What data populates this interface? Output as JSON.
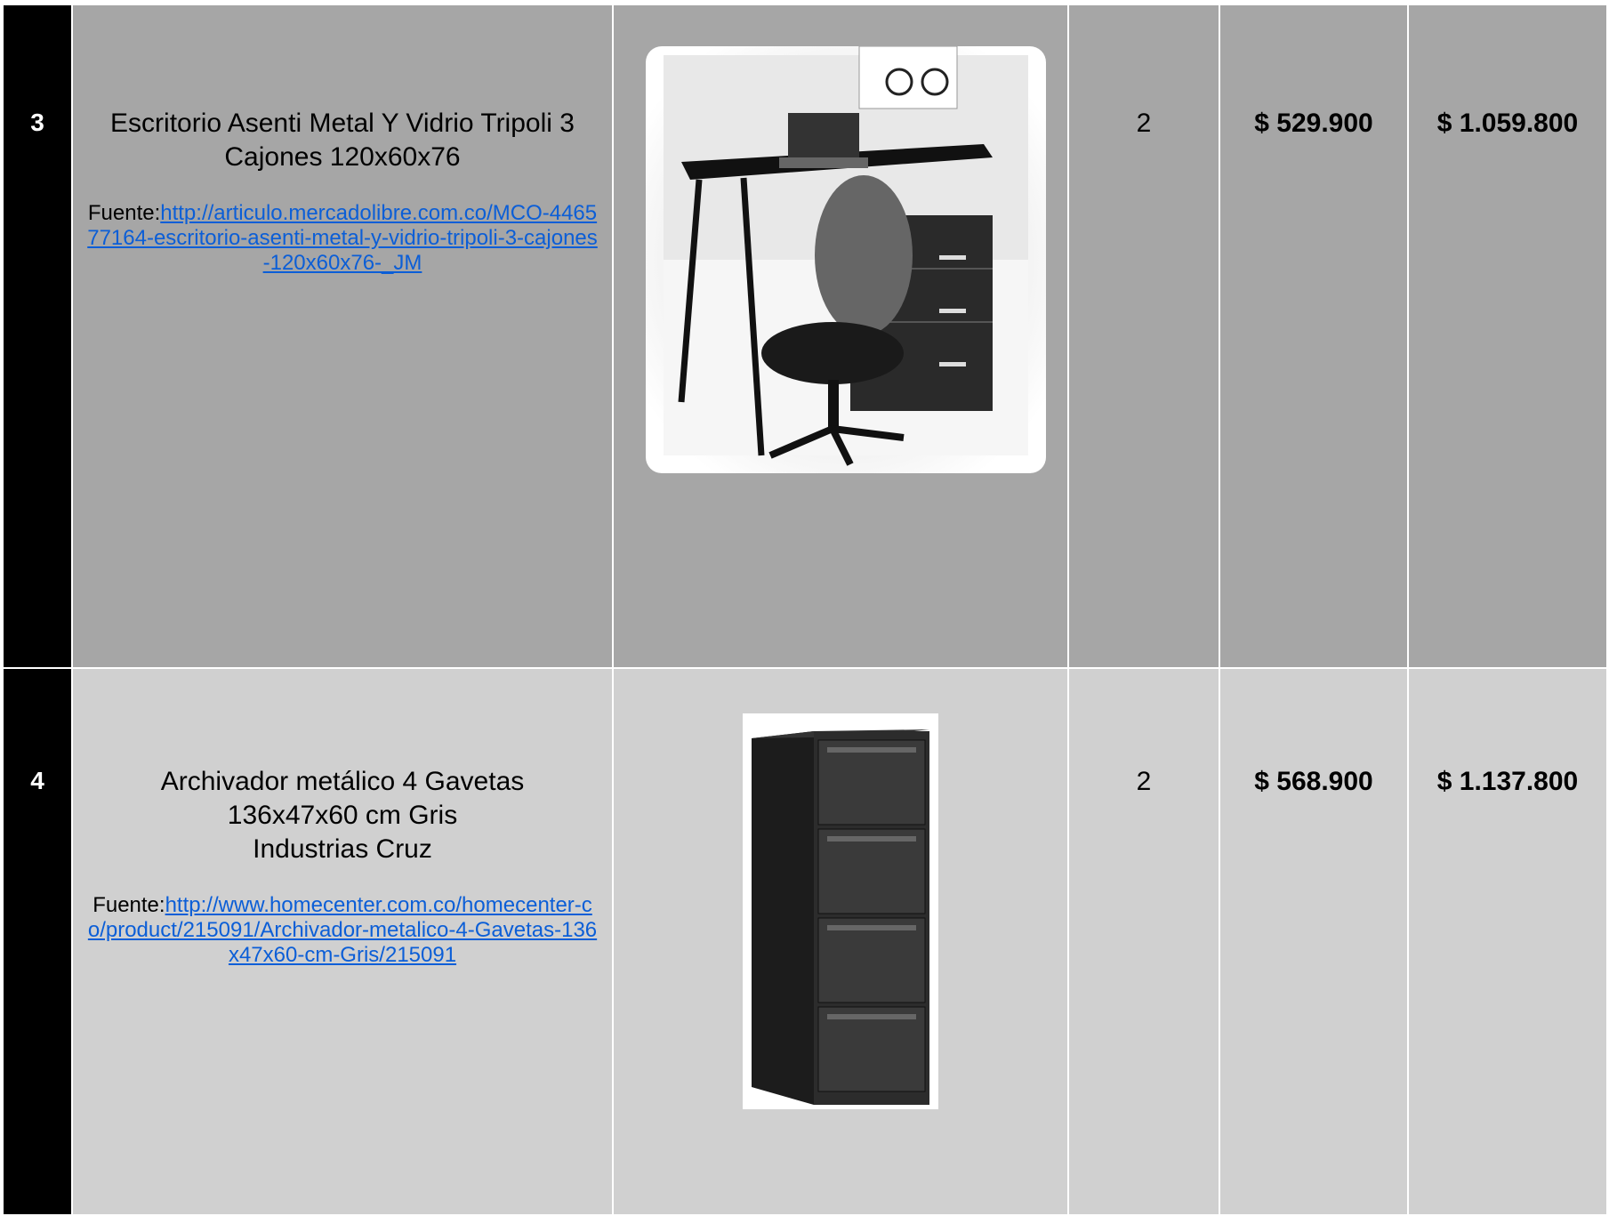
{
  "rows": [
    {
      "number": "3",
      "title": "Escritorio Asenti Metal Y Vidrio Tripoli 3 Cajones 120x60x76",
      "source_prefix": "Fuente:",
      "source_link": "http://articulo.mercadolibre.com.co/MCO-446577164-escritorio-asenti-metal-y-vidrio-tripoli-3-cajones-120x60x76-_JM",
      "quantity": "2",
      "unit_price": "$ 529.900",
      "total": "$ 1.059.800",
      "image_icon": "desk-chair-photo"
    },
    {
      "number": "4",
      "title_lines": [
        "Archivador metálico 4 Gavetas",
        "136x47x60 cm Gris",
        "Industrias Cruz"
      ],
      "source_prefix": "Fuente:",
      "source_link": "http://www.homecenter.com.co/homecenter-co/product/215091/Archivador-metalico-4-Gavetas-136x47x60-cm-Gris/215091",
      "quantity": "2",
      "unit_price": "$ 568.900",
      "total": "$ 1.137.800",
      "image_icon": "filing-cabinet-photo"
    }
  ],
  "colors": {
    "row3_bg": "#a6a6a6",
    "row4_bg": "#d0d0d0",
    "number_col_bg": "#000000",
    "link": "#0b5ed7"
  }
}
